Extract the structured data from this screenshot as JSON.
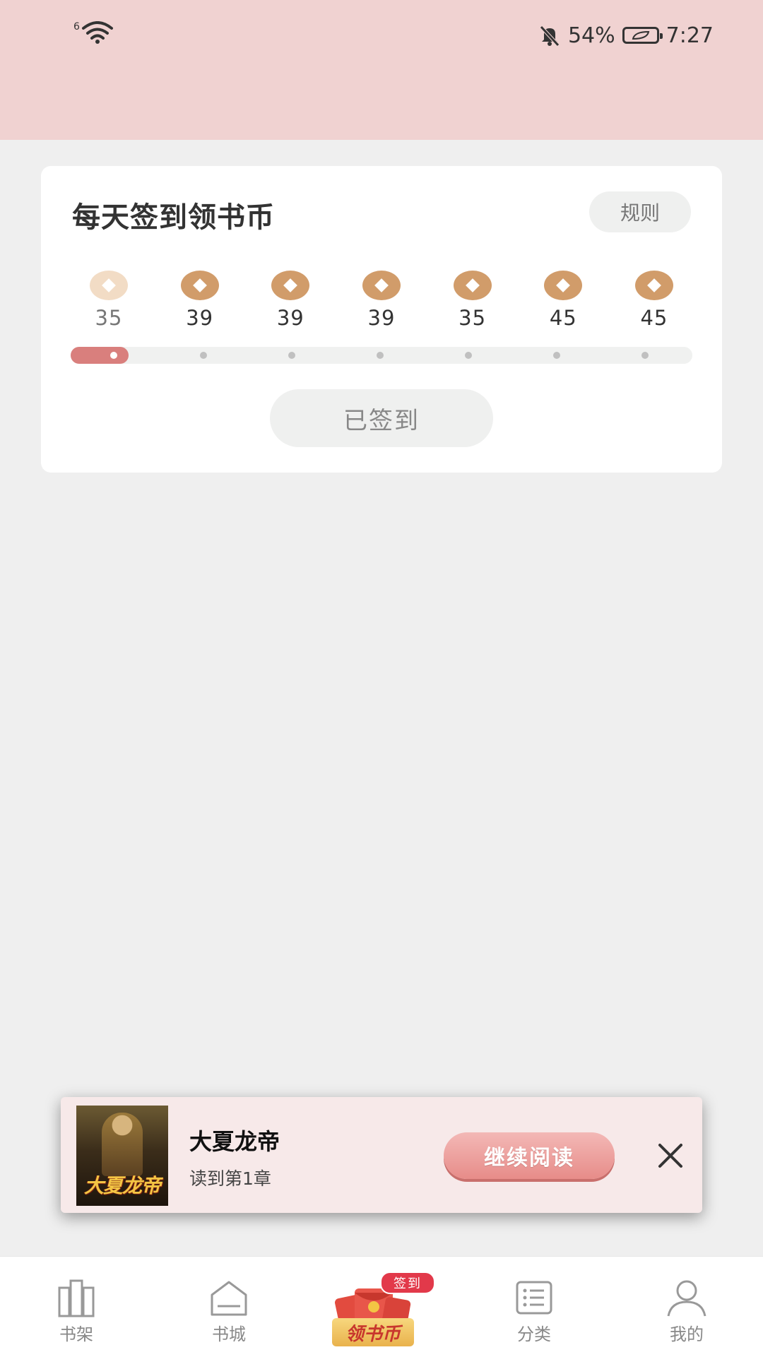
{
  "status_bar": {
    "network": "6",
    "battery": "54%",
    "time": "7:27"
  },
  "checkin": {
    "title": "每天签到领书币",
    "rules_label": "规则",
    "days": [
      {
        "value": "35",
        "checked": true
      },
      {
        "value": "39",
        "checked": false
      },
      {
        "value": "39",
        "checked": false
      },
      {
        "value": "39",
        "checked": false
      },
      {
        "value": "35",
        "checked": false
      },
      {
        "value": "45",
        "checked": false
      },
      {
        "value": "45",
        "checked": false
      }
    ],
    "days_checked": 1,
    "button_label": "已签到",
    "colors": {
      "coin": "#d19c6a",
      "coin_done": "#f2dcc5",
      "progress": "#d97f7d"
    }
  },
  "continue_reading": {
    "book_title": "大夏龙帝",
    "progress": "读到第1章",
    "button_label": "继续阅读",
    "cover_text": "大夏龙帝"
  },
  "tabbar": {
    "tabs": [
      {
        "label": "书架",
        "icon": "bookshelf-icon"
      },
      {
        "label": "书城",
        "icon": "bookstore-icon"
      },
      {
        "label": "领书币",
        "icon": "red-envelope-icon",
        "badge": "签到"
      },
      {
        "label": "分类",
        "icon": "category-list-icon"
      },
      {
        "label": "我的",
        "icon": "user-icon"
      }
    ]
  }
}
